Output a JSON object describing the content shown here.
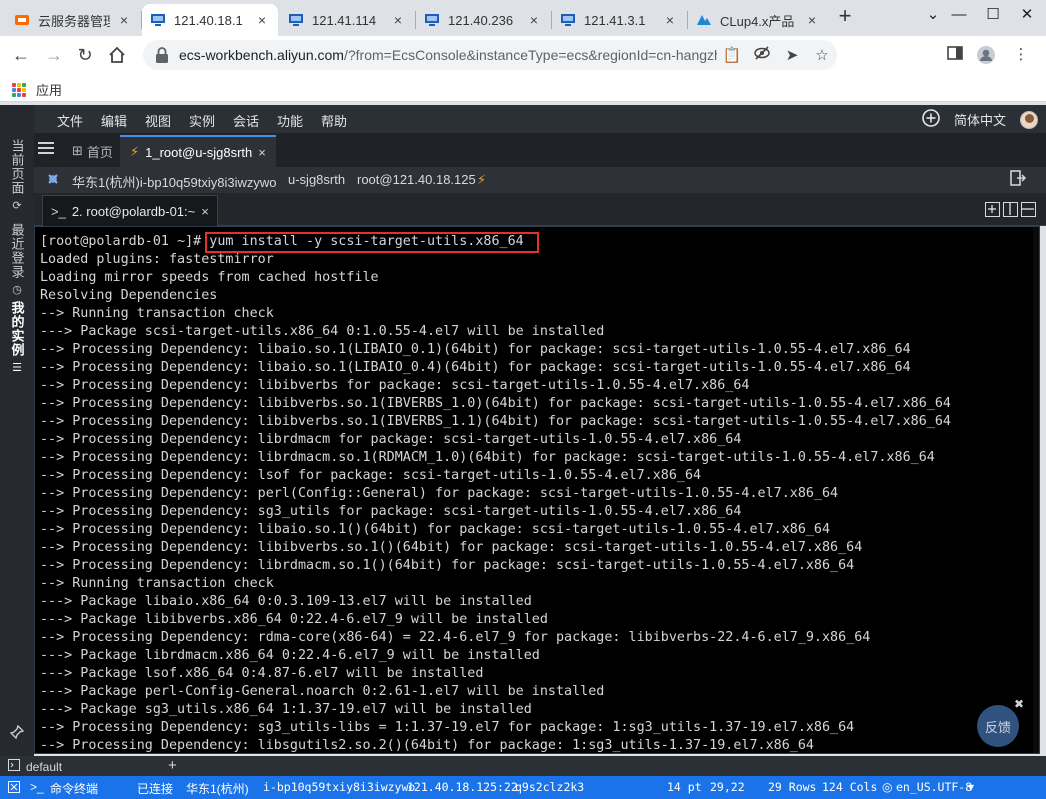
{
  "browser": {
    "tabs": [
      {
        "title": "云服务器管理",
        "icon": "ecs-console-icon",
        "active": false
      },
      {
        "title": "121.40.18.1",
        "icon": "server-icon",
        "active": true
      },
      {
        "title": "121.41.114",
        "icon": "server-icon",
        "active": false
      },
      {
        "title": "121.40.236",
        "icon": "server-icon",
        "active": false
      },
      {
        "title": "121.41.3.1",
        "icon": "server-icon",
        "active": false
      },
      {
        "title": "CLup4.x产品",
        "icon": "clup-icon",
        "active": false
      }
    ],
    "close_glyph": "×",
    "new_tab_glyph": "+",
    "window_buttons": {
      "collapse": "⌄",
      "minimize": "—",
      "maximize": "☐",
      "close": "✕"
    },
    "address": {
      "host": "ecs-workbench.aliyun.com",
      "path": "/?from=EcsConsole&instanceType=ecs&regionId=cn-hangzhou&instanc…"
    },
    "bookmarks": {
      "apps_label": "应用"
    }
  },
  "workbench": {
    "menu": [
      "文件",
      "编辑",
      "视图",
      "实例",
      "会话",
      "功能",
      "帮助"
    ],
    "language": "简体中文",
    "side_tabs": [
      "当前页面",
      "最近登录",
      "我的实例"
    ],
    "tabs": {
      "home": "首页",
      "session": "1_root@u-sjg8srth"
    },
    "info": {
      "region_instance": "华东1(杭州)i-bp10q59txiy8i3iwzywo",
      "user_id": "u-sjg8srth",
      "login": "root@121.40.18.125"
    },
    "subtab": "2. root@polardb-01:~",
    "terminal_lines": [
      "[root@polardb-01 ~]# yum install -y scsi-target-utils.x86_64",
      "Loaded plugins: fastestmirror",
      "Loading mirror speeds from cached hostfile",
      "Resolving Dependencies",
      "--> Running transaction check",
      "---> Package scsi-target-utils.x86_64 0:1.0.55-4.el7 will be installed",
      "--> Processing Dependency: libaio.so.1(LIBAIO_0.1)(64bit) for package: scsi-target-utils-1.0.55-4.el7.x86_64",
      "--> Processing Dependency: libaio.so.1(LIBAIO_0.4)(64bit) for package: scsi-target-utils-1.0.55-4.el7.x86_64",
      "--> Processing Dependency: libibverbs for package: scsi-target-utils-1.0.55-4.el7.x86_64",
      "--> Processing Dependency: libibverbs.so.1(IBVERBS_1.0)(64bit) for package: scsi-target-utils-1.0.55-4.el7.x86_64",
      "--> Processing Dependency: libibverbs.so.1(IBVERBS_1.1)(64bit) for package: scsi-target-utils-1.0.55-4.el7.x86_64",
      "--> Processing Dependency: librdmacm for package: scsi-target-utils-1.0.55-4.el7.x86_64",
      "--> Processing Dependency: librdmacm.so.1(RDMACM_1.0)(64bit) for package: scsi-target-utils-1.0.55-4.el7.x86_64",
      "--> Processing Dependency: lsof for package: scsi-target-utils-1.0.55-4.el7.x86_64",
      "--> Processing Dependency: perl(Config::General) for package: scsi-target-utils-1.0.55-4.el7.x86_64",
      "--> Processing Dependency: sg3_utils for package: scsi-target-utils-1.0.55-4.el7.x86_64",
      "--> Processing Dependency: libaio.so.1()(64bit) for package: scsi-target-utils-1.0.55-4.el7.x86_64",
      "--> Processing Dependency: libibverbs.so.1()(64bit) for package: scsi-target-utils-1.0.55-4.el7.x86_64",
      "--> Processing Dependency: librdmacm.so.1()(64bit) for package: scsi-target-utils-1.0.55-4.el7.x86_64",
      "--> Running transaction check",
      "---> Package libaio.x86_64 0:0.3.109-13.el7 will be installed",
      "---> Package libibverbs.x86_64 0:22.4-6.el7_9 will be installed",
      "--> Processing Dependency: rdma-core(x86-64) = 22.4-6.el7_9 for package: libibverbs-22.4-6.el7_9.x86_64",
      "---> Package librdmacm.x86_64 0:22.4-6.el7_9 will be installed",
      "---> Package lsof.x86_64 0:4.87-6.el7 will be installed",
      "---> Package perl-Config-General.noarch 0:2.61-1.el7 will be installed",
      "---> Package sg3_utils.x86_64 1:1.37-19.el7 will be installed",
      "--> Processing Dependency: sg3_utils-libs = 1:1.37-19.el7 for package: 1:sg3_utils-1.37-19.el7.x86_64",
      "--> Processing Dependency: libsgutils2.so.2()(64bit) for package: 1:sg3_utils-1.37-19.el7.x86_64"
    ],
    "feedback": "反馈",
    "bottom": {
      "profile": "default",
      "add": "+"
    },
    "status": {
      "terminal": "命令终端",
      "connection": "已连接",
      "region": "华东1(杭州)",
      "instance": "i-bp10q59txiy8i3iwzywo",
      "address": "121.40.18.125:22",
      "session": "q9s2clz2k3",
      "font_size": "14 pt",
      "cursor": "29,22",
      "rows": "29 Rows",
      "cols": "124 Cols",
      "locale": "en_US.UTF-8"
    },
    "colors": {
      "status_bg": "#1a73e8",
      "highlight": "#e53030",
      "terminal_bg": "#000000"
    }
  }
}
